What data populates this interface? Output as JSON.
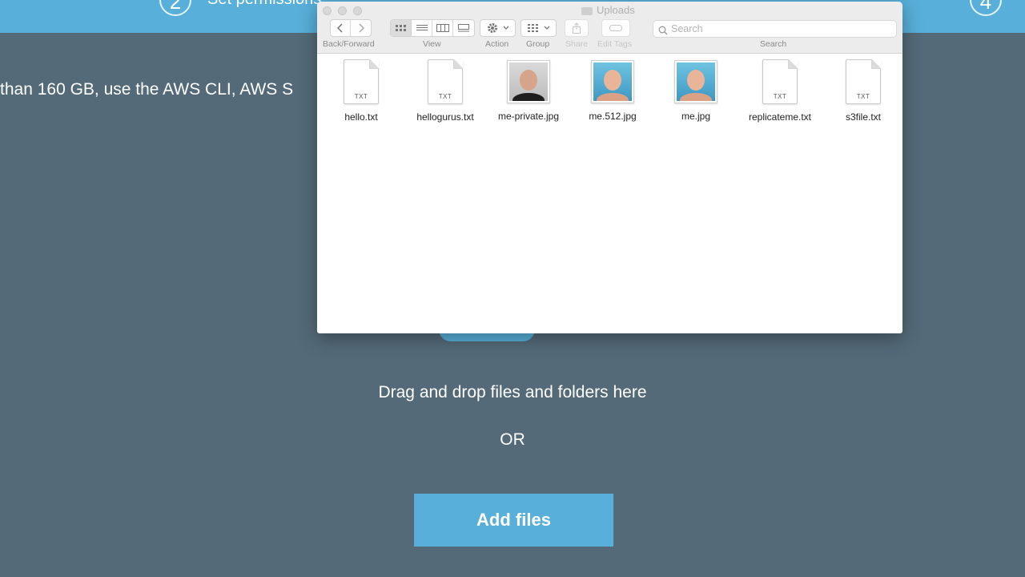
{
  "steps": [
    {
      "number": "2",
      "label": "Set permissions"
    },
    {
      "number": "4",
      "label": ""
    }
  ],
  "info_text": "than 160 GB, use the AWS CLI, AWS S",
  "drop_text": "Drag and drop files and folders here",
  "or_text": "OR",
  "add_files_label": "Add files",
  "finder": {
    "title": "Uploads",
    "toolbar": {
      "back_forward": "Back/Forward",
      "view": "View",
      "action": "Action",
      "group": "Group",
      "share": "Share",
      "edit_tags": "Edit Tags",
      "search_caption": "Search",
      "search_placeholder": "Search"
    },
    "files": [
      {
        "name": "hello.txt",
        "type": "TXT"
      },
      {
        "name": "hellogurus.txt",
        "type": "TXT"
      },
      {
        "name": "me-private.jpg",
        "type": "image",
        "icon": "portrait-dark-icon"
      },
      {
        "name": "me.512.jpg",
        "type": "image",
        "icon": "portrait-blue-icon"
      },
      {
        "name": "me.jpg",
        "type": "image",
        "icon": "portrait-blue-icon"
      },
      {
        "name": "replicateme.txt",
        "type": "TXT"
      },
      {
        "name": "s3file.txt",
        "type": "TXT"
      }
    ]
  },
  "colors": {
    "background": "#546a78",
    "accent": "#58afd9"
  }
}
